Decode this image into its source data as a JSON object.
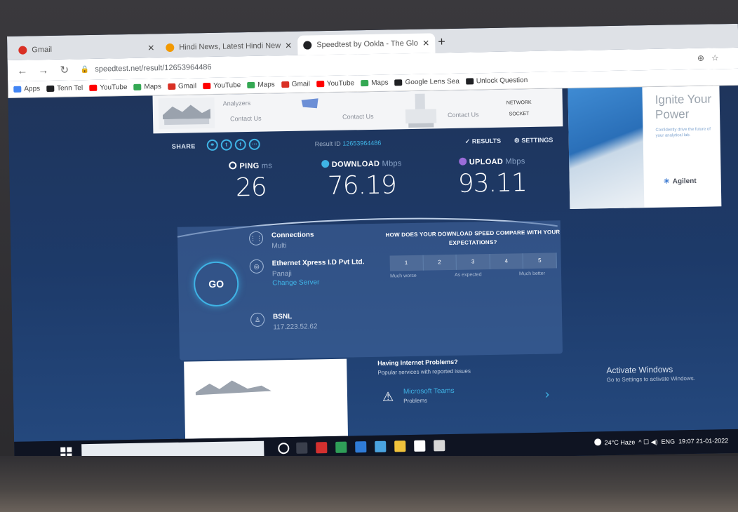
{
  "browser": {
    "tabs": [
      {
        "title": "Gmail",
        "favicon_color": "#d93025",
        "active": false
      },
      {
        "title": "Hindi News, Latest Hindi News",
        "favicon_color": "#f29900",
        "active": false
      },
      {
        "title": "Speedtest by Ookla - The Glob",
        "favicon_color": "#202124",
        "active": true
      }
    ],
    "new_tab": "+",
    "close": "✕",
    "url": "speedtest.net/result/12653964486",
    "nav": {
      "back": "←",
      "forward": "→",
      "reload": "↻"
    },
    "bookmarks": [
      {
        "label": "Apps",
        "color": "#4285f4"
      },
      {
        "label": "Tenn Tel",
        "color": "#202124"
      },
      {
        "label": "YouTube",
        "color": "#ff0000"
      },
      {
        "label": "Maps",
        "color": "#34a853"
      },
      {
        "label": "Gmail",
        "color": "#d93025"
      },
      {
        "label": "YouTube",
        "color": "#ff0000"
      },
      {
        "label": "Maps",
        "color": "#34a853"
      },
      {
        "label": "Gmail",
        "color": "#d93025"
      },
      {
        "label": "YouTube",
        "color": "#ff0000"
      },
      {
        "label": "Maps",
        "color": "#34a853"
      },
      {
        "label": "Google Lens Sea",
        "color": "#202124"
      },
      {
        "label": "Unlock Question",
        "color": "#202124"
      }
    ]
  },
  "ad_top": {
    "cells": [
      "Analyzers",
      "Contact Us",
      "Contact Us",
      "Contact Us"
    ],
    "button": "NETWORK SOCKET"
  },
  "ad_right": {
    "title": "Ignite Your Power",
    "subtitle": "Confidently drive the future of your analytical lab.",
    "brand": "Agilent",
    "brand_mark": "☀"
  },
  "speedtest": {
    "share_label": "SHARE",
    "result_label": "Result ID",
    "result_id": "12653964486",
    "results_label": "RESULTS",
    "settings_label": "SETTINGS",
    "metrics": [
      {
        "name": "PING",
        "unit": "ms",
        "value": "26",
        "icon_color": "#ffffff"
      },
      {
        "name": "DOWNLOAD",
        "unit": "Mbps",
        "value": "76.19",
        "icon_color": "#3fb4e6"
      },
      {
        "name": "UPLOAD",
        "unit": "Mbps",
        "value": "93.11",
        "icon_color": "#9b6cd9"
      }
    ],
    "go_label": "GO",
    "connections": {
      "title": "Connections",
      "value": "Multi"
    },
    "host": {
      "name": "Ethernet Xpress I.D Pvt Ltd.",
      "location": "Panaji",
      "link": "Change Server"
    },
    "isp": {
      "name": "BSNL",
      "ip": "117.223.52.62"
    },
    "survey": {
      "question": "HOW DOES YOUR DOWNLOAD SPEED COMPARE WITH YOUR EXPECTATIONS?",
      "scale": [
        "1",
        "2",
        "3",
        "4",
        "5"
      ],
      "low_label": "Much worse",
      "mid_label": "As expected",
      "high_label": "Much better"
    }
  },
  "problems": {
    "title": "Having Internet Problems?",
    "subtitle": "Popular services with reported issues",
    "service": "Microsoft Teams",
    "count": "Problems"
  },
  "activate_windows": {
    "title": "Activate Windows",
    "subtitle": "Go to Settings to activate Windows."
  },
  "taskbar": {
    "weather": "24°C Haze",
    "time": "19:07",
    "date": "21-01-2022",
    "lang": "ENG"
  }
}
